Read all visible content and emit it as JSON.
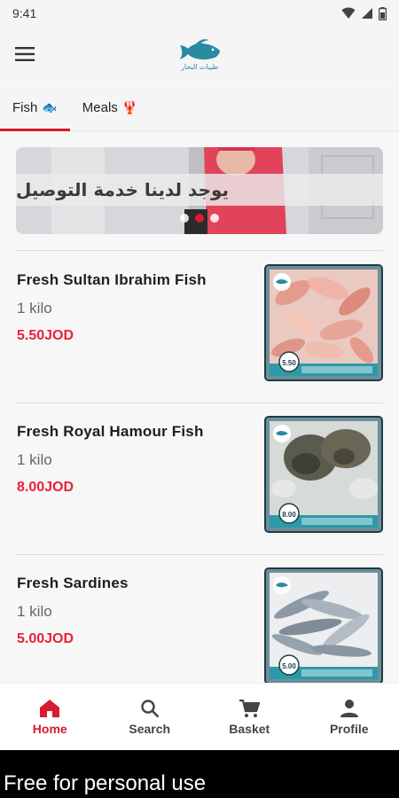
{
  "status_bar": {
    "time": "9:41",
    "icons": [
      "wifi-icon",
      "signal-icon",
      "battery-icon"
    ]
  },
  "app_bar": {
    "menu_icon": "hamburger-menu-icon",
    "logo_text": "طيبات البحار"
  },
  "tabs": [
    {
      "label": "Fish",
      "emoji": "🐟",
      "active": true
    },
    {
      "label": "Meals",
      "emoji": "🦞",
      "active": false
    }
  ],
  "banner": {
    "text": "يوجد لدينا خدمة التوصيل",
    "dots": 3,
    "active_dot": 1
  },
  "products": [
    {
      "name": "Fresh Sultan Ibrahim Fish",
      "quantity": "1 kilo",
      "price": "5.50JOD",
      "image": "sultan-ibrahim-fish-image",
      "image_price": "5.50"
    },
    {
      "name": "Fresh Royal Hamour Fish",
      "quantity": "1 kilo",
      "price": "8.00JOD",
      "image": "royal-hamour-fish-image",
      "image_price": "8.00"
    },
    {
      "name": "Fresh Sardines",
      "quantity": "1 kilo",
      "price": "5.00JOD",
      "image": "sardines-image",
      "image_price": "5.00"
    }
  ],
  "bottom_nav": [
    {
      "label": "Home",
      "icon": "home-icon",
      "active": true
    },
    {
      "label": "Search",
      "icon": "search-icon",
      "active": false
    },
    {
      "label": "Basket",
      "icon": "cart-icon",
      "active": false
    },
    {
      "label": "Profile",
      "icon": "person-icon",
      "active": false
    }
  ],
  "watermark": "Free for personal use",
  "colors": {
    "accent": "#d81b2e",
    "price": "#e8213a",
    "logo": "#2a8aa0"
  }
}
